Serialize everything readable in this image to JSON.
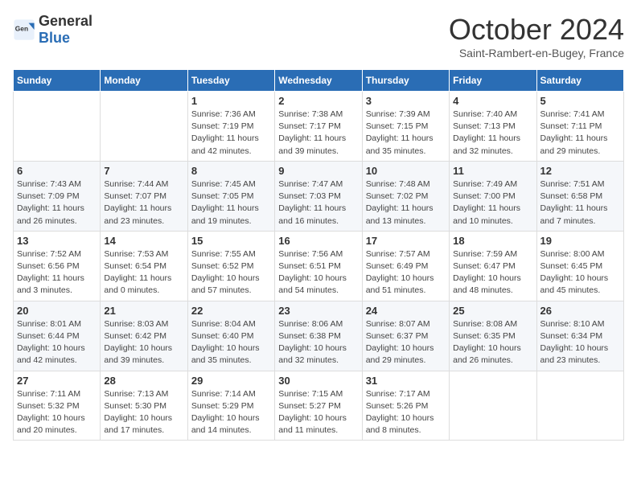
{
  "header": {
    "logo": {
      "text_general": "General",
      "text_blue": "Blue"
    },
    "title": "October 2024",
    "subtitle": "Saint-Rambert-en-Bugey, France"
  },
  "days_of_week": [
    "Sunday",
    "Monday",
    "Tuesday",
    "Wednesday",
    "Thursday",
    "Friday",
    "Saturday"
  ],
  "weeks": [
    [
      {
        "day": "",
        "info": ""
      },
      {
        "day": "",
        "info": ""
      },
      {
        "day": "1",
        "info": "Sunrise: 7:36 AM\nSunset: 7:19 PM\nDaylight: 11 hours and 42 minutes."
      },
      {
        "day": "2",
        "info": "Sunrise: 7:38 AM\nSunset: 7:17 PM\nDaylight: 11 hours and 39 minutes."
      },
      {
        "day": "3",
        "info": "Sunrise: 7:39 AM\nSunset: 7:15 PM\nDaylight: 11 hours and 35 minutes."
      },
      {
        "day": "4",
        "info": "Sunrise: 7:40 AM\nSunset: 7:13 PM\nDaylight: 11 hours and 32 minutes."
      },
      {
        "day": "5",
        "info": "Sunrise: 7:41 AM\nSunset: 7:11 PM\nDaylight: 11 hours and 29 minutes."
      }
    ],
    [
      {
        "day": "6",
        "info": "Sunrise: 7:43 AM\nSunset: 7:09 PM\nDaylight: 11 hours and 26 minutes."
      },
      {
        "day": "7",
        "info": "Sunrise: 7:44 AM\nSunset: 7:07 PM\nDaylight: 11 hours and 23 minutes."
      },
      {
        "day": "8",
        "info": "Sunrise: 7:45 AM\nSunset: 7:05 PM\nDaylight: 11 hours and 19 minutes."
      },
      {
        "day": "9",
        "info": "Sunrise: 7:47 AM\nSunset: 7:03 PM\nDaylight: 11 hours and 16 minutes."
      },
      {
        "day": "10",
        "info": "Sunrise: 7:48 AM\nSunset: 7:02 PM\nDaylight: 11 hours and 13 minutes."
      },
      {
        "day": "11",
        "info": "Sunrise: 7:49 AM\nSunset: 7:00 PM\nDaylight: 11 hours and 10 minutes."
      },
      {
        "day": "12",
        "info": "Sunrise: 7:51 AM\nSunset: 6:58 PM\nDaylight: 11 hours and 7 minutes."
      }
    ],
    [
      {
        "day": "13",
        "info": "Sunrise: 7:52 AM\nSunset: 6:56 PM\nDaylight: 11 hours and 3 minutes."
      },
      {
        "day": "14",
        "info": "Sunrise: 7:53 AM\nSunset: 6:54 PM\nDaylight: 11 hours and 0 minutes."
      },
      {
        "day": "15",
        "info": "Sunrise: 7:55 AM\nSunset: 6:52 PM\nDaylight: 10 hours and 57 minutes."
      },
      {
        "day": "16",
        "info": "Sunrise: 7:56 AM\nSunset: 6:51 PM\nDaylight: 10 hours and 54 minutes."
      },
      {
        "day": "17",
        "info": "Sunrise: 7:57 AM\nSunset: 6:49 PM\nDaylight: 10 hours and 51 minutes."
      },
      {
        "day": "18",
        "info": "Sunrise: 7:59 AM\nSunset: 6:47 PM\nDaylight: 10 hours and 48 minutes."
      },
      {
        "day": "19",
        "info": "Sunrise: 8:00 AM\nSunset: 6:45 PM\nDaylight: 10 hours and 45 minutes."
      }
    ],
    [
      {
        "day": "20",
        "info": "Sunrise: 8:01 AM\nSunset: 6:44 PM\nDaylight: 10 hours and 42 minutes."
      },
      {
        "day": "21",
        "info": "Sunrise: 8:03 AM\nSunset: 6:42 PM\nDaylight: 10 hours and 39 minutes."
      },
      {
        "day": "22",
        "info": "Sunrise: 8:04 AM\nSunset: 6:40 PM\nDaylight: 10 hours and 35 minutes."
      },
      {
        "day": "23",
        "info": "Sunrise: 8:06 AM\nSunset: 6:38 PM\nDaylight: 10 hours and 32 minutes."
      },
      {
        "day": "24",
        "info": "Sunrise: 8:07 AM\nSunset: 6:37 PM\nDaylight: 10 hours and 29 minutes."
      },
      {
        "day": "25",
        "info": "Sunrise: 8:08 AM\nSunset: 6:35 PM\nDaylight: 10 hours and 26 minutes."
      },
      {
        "day": "26",
        "info": "Sunrise: 8:10 AM\nSunset: 6:34 PM\nDaylight: 10 hours and 23 minutes."
      }
    ],
    [
      {
        "day": "27",
        "info": "Sunrise: 7:11 AM\nSunset: 5:32 PM\nDaylight: 10 hours and 20 minutes."
      },
      {
        "day": "28",
        "info": "Sunrise: 7:13 AM\nSunset: 5:30 PM\nDaylight: 10 hours and 17 minutes."
      },
      {
        "day": "29",
        "info": "Sunrise: 7:14 AM\nSunset: 5:29 PM\nDaylight: 10 hours and 14 minutes."
      },
      {
        "day": "30",
        "info": "Sunrise: 7:15 AM\nSunset: 5:27 PM\nDaylight: 10 hours and 11 minutes."
      },
      {
        "day": "31",
        "info": "Sunrise: 7:17 AM\nSunset: 5:26 PM\nDaylight: 10 hours and 8 minutes."
      },
      {
        "day": "",
        "info": ""
      },
      {
        "day": "",
        "info": ""
      }
    ]
  ]
}
